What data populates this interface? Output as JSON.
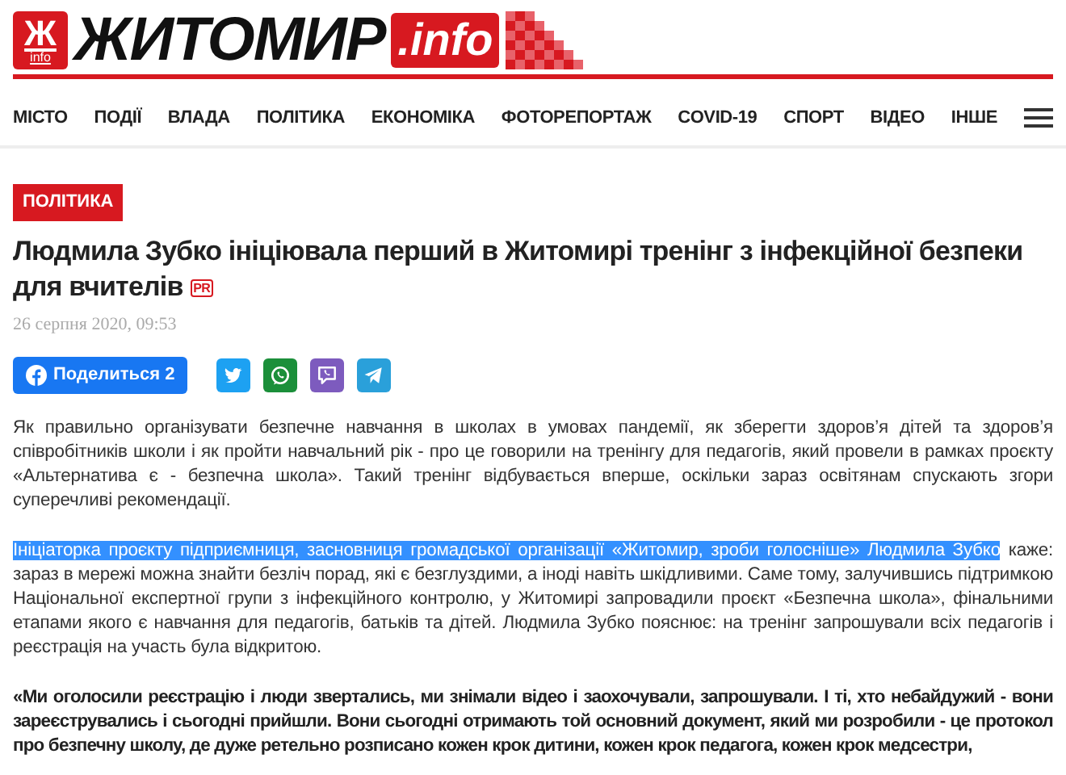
{
  "logo": {
    "mark": "Ж",
    "mark_sub": "info",
    "name": "ЖИТОМИР",
    "suffix": ".info"
  },
  "nav": {
    "items": [
      "МІСТО",
      "ПОДІЇ",
      "ВЛАДА",
      "ПОЛІТИКА",
      "ЕКОНОМІКА",
      "ФОТОРЕПОРТАЖ",
      "COVID-19",
      "СПОРТ",
      "ВІДЕО",
      "ІНШЕ"
    ]
  },
  "article": {
    "category": "ПОЛІТИКА",
    "title": "Людмила Зубко ініціювала перший в Житомирі тренінг з інфекційної безпеки для вчителів",
    "pr_badge": "PR",
    "date": "26 серпня 2020, 09:53",
    "share": [
      {
        "kind": "facebook",
        "label": "Поделиться 2"
      },
      {
        "kind": "twitter"
      },
      {
        "kind": "whatsapp"
      },
      {
        "kind": "viber"
      },
      {
        "kind": "telegram"
      }
    ],
    "paragraphs": [
      {
        "bold": false,
        "parts": [
          {
            "text": "Як правильно організувати безпечне навчання в школах в умовах пандемії, як зберегти здоров’я дітей та здоров’я співробітників школи і як пройти навчальний рік - про це говорили на тренінгу для педагогів, який провели в рамках проєкту «Альтернатива є - безпечна школа». Такий тренінг відбувається вперше, оскільки зараз освітянам спускають згори суперечливі рекомендації.",
            "selected": false
          }
        ]
      },
      {
        "bold": false,
        "parts": [
          {
            "text": "Ініціаторка проєкту підприємниця, засновниця громадської організації «Житомир, зроби голосніше» Людмила Зубко",
            "selected": true
          },
          {
            "text": " каже: зараз в мережі можна знайти безліч порад, які є безглуздими, а іноді навіть шкідливими. Саме тому, залучившись підтримкою Національної експертної групи з інфекційного контролю, у Житомирі запровадили проєкт «Безпечна школа», фінальними етапами якого є навчання для педагогів, батьків та дітей. Людмила Зубко пояснює: на тренінг запрошували всіх педагогів і реєстрація на участь була відкритою.",
            "selected": false
          }
        ]
      },
      {
        "bold": true,
        "parts": [
          {
            "text": "«Ми оголосили реєстрацію і люди звертались, ми знімали відео і заохочували, запрошували. І ті, хто небайдужий - вони зареєструвались і сьогодні прийшли. Вони сьогодні отримають той основний документ, який ми розробили - це протокол про безпечну школу, де дуже ретельно розписано кожен крок дитини, кожен крок педагога, кожен крок медсестри,",
            "selected": false
          }
        ]
      }
    ]
  }
}
